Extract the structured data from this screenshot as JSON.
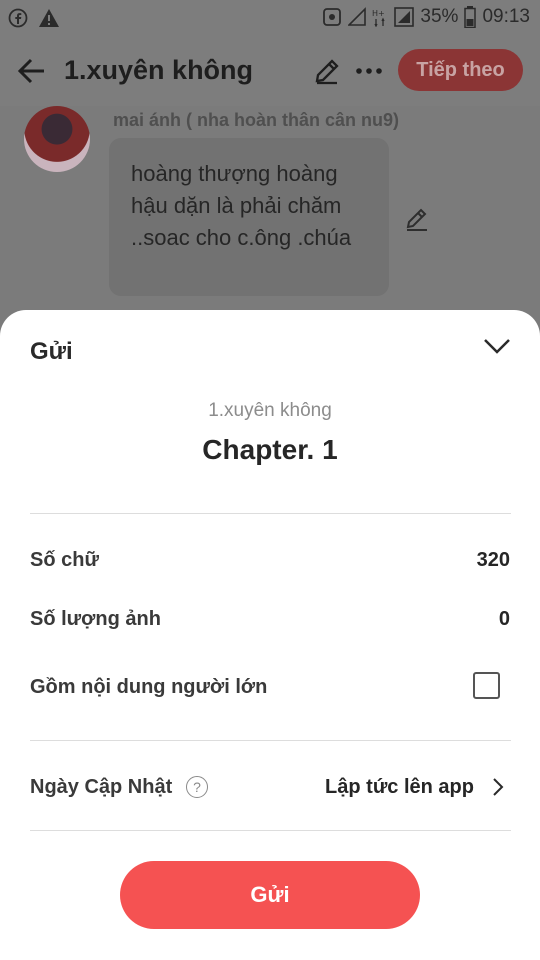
{
  "status_bar": {
    "battery": "35%",
    "time": "09:13",
    "icons": [
      "facebook-icon",
      "warning-icon",
      "nfc-icon",
      "signal-icon",
      "data-icon",
      "signal-icon",
      "battery-icon"
    ]
  },
  "app_bar": {
    "title": "1.xuyên không",
    "next_label": "Tiếp theo"
  },
  "chat": {
    "speaker": "mai ánh ( nha hoàn thân cân nu9)",
    "message": "hoàng thượng hoàng hậu dặn là phải chăm ..soac cho c.ông .chúa"
  },
  "sheet": {
    "title": "Gửi",
    "story_name": "1.xuyên không",
    "chapter_name": "Chapter. 1",
    "rows": [
      {
        "label": "Số chữ",
        "value": "320"
      },
      {
        "label": "Số lượng ảnh",
        "value": "0"
      },
      {
        "label": "Gồm nội dung người lớn"
      }
    ],
    "adult_content_checked": false,
    "update_label": "Ngày Cập Nhật",
    "help_glyph": "?",
    "update_value": "Lập tức lên app",
    "submit_label": "Gửi"
  },
  "colors": {
    "accent": "#f55252",
    "overlay": "#7b7b7b"
  }
}
